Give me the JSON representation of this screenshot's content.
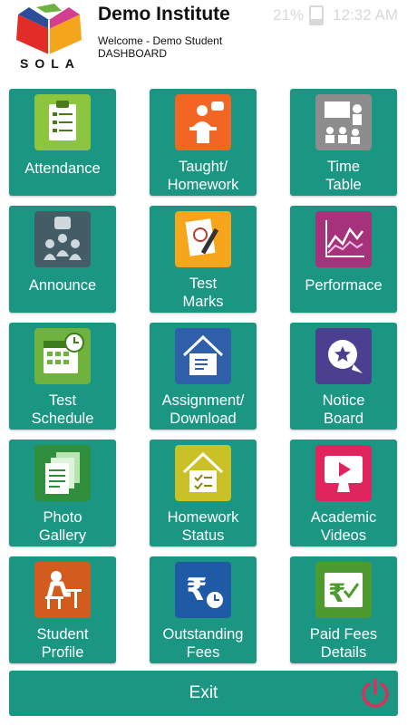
{
  "status": {
    "battery": "21%",
    "time": "12:32 AM"
  },
  "header": {
    "logo_text": "SOLA",
    "institute": "Demo Institute",
    "welcome": "Welcome - Demo Student",
    "section": "DASHBOARD"
  },
  "tiles": [
    {
      "label": "Attendance",
      "icon": "attendance-clipboard-icon"
    },
    {
      "label": "Taught/\nHomework",
      "icon": "lecturer-podium-icon"
    },
    {
      "label": "Time\nTable",
      "icon": "classroom-board-icon"
    },
    {
      "label": "Announce",
      "icon": "announce-people-icon"
    },
    {
      "label": "Test\nMarks",
      "icon": "test-paper-icon"
    },
    {
      "label": "Performace",
      "icon": "line-chart-icon"
    },
    {
      "label": "Test\nSchedule",
      "icon": "calendar-clock-icon"
    },
    {
      "label": "Assignment/\nDownload",
      "icon": "house-document-icon"
    },
    {
      "label": "Notice\nBoard",
      "icon": "notice-star-icon"
    },
    {
      "label": "Photo\nGallery",
      "icon": "documents-icon"
    },
    {
      "label": "Homework\nStatus",
      "icon": "house-checklist-icon"
    },
    {
      "label": "Academic\nVideos",
      "icon": "video-play-icon"
    },
    {
      "label": "Student\nProfile",
      "icon": "student-desk-icon"
    },
    {
      "label": "Outstanding\nFees",
      "icon": "rupee-clock-icon"
    },
    {
      "label": "Paid Fees\nDetails",
      "icon": "rupee-check-icon"
    }
  ],
  "exit": {
    "label": "Exit",
    "icon": "power-icon"
  }
}
